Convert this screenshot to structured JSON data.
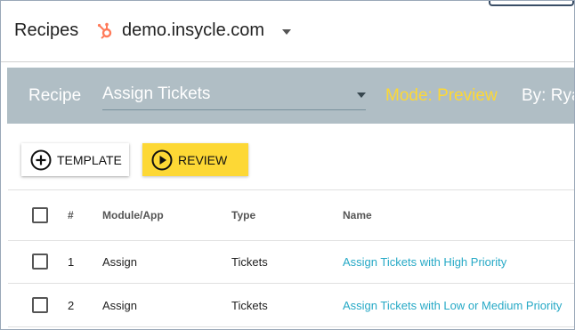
{
  "header": {
    "title": "Recipes",
    "portal": "demo.insycle.com",
    "portal_icon": "hubspot-sprocket-icon",
    "brand_color": "#ff7a59"
  },
  "recipe_bar": {
    "label": "Recipe",
    "selected_recipe": "Assign Tickets",
    "mode": "Mode: Preview",
    "by": "By: Rya",
    "background": "#b0bec5",
    "mode_color": "#fdd835"
  },
  "toolbar": {
    "template_label": "TEMPLATE",
    "template_icon": "plus-circle-icon",
    "review_label": "REVIEW",
    "review_icon": "play-circle-icon",
    "review_color": "#fdd835"
  },
  "table": {
    "columns": [
      "#",
      "Module/App",
      "Type",
      "Name"
    ],
    "rows": [
      {
        "num": "1",
        "module": "Assign",
        "type": "Tickets",
        "name": "Assign Tickets with High Priority"
      },
      {
        "num": "2",
        "module": "Assign",
        "type": "Tickets",
        "name": "Assign Tickets with Low or Medium Priority"
      }
    ],
    "link_color": "#26a9c6"
  }
}
